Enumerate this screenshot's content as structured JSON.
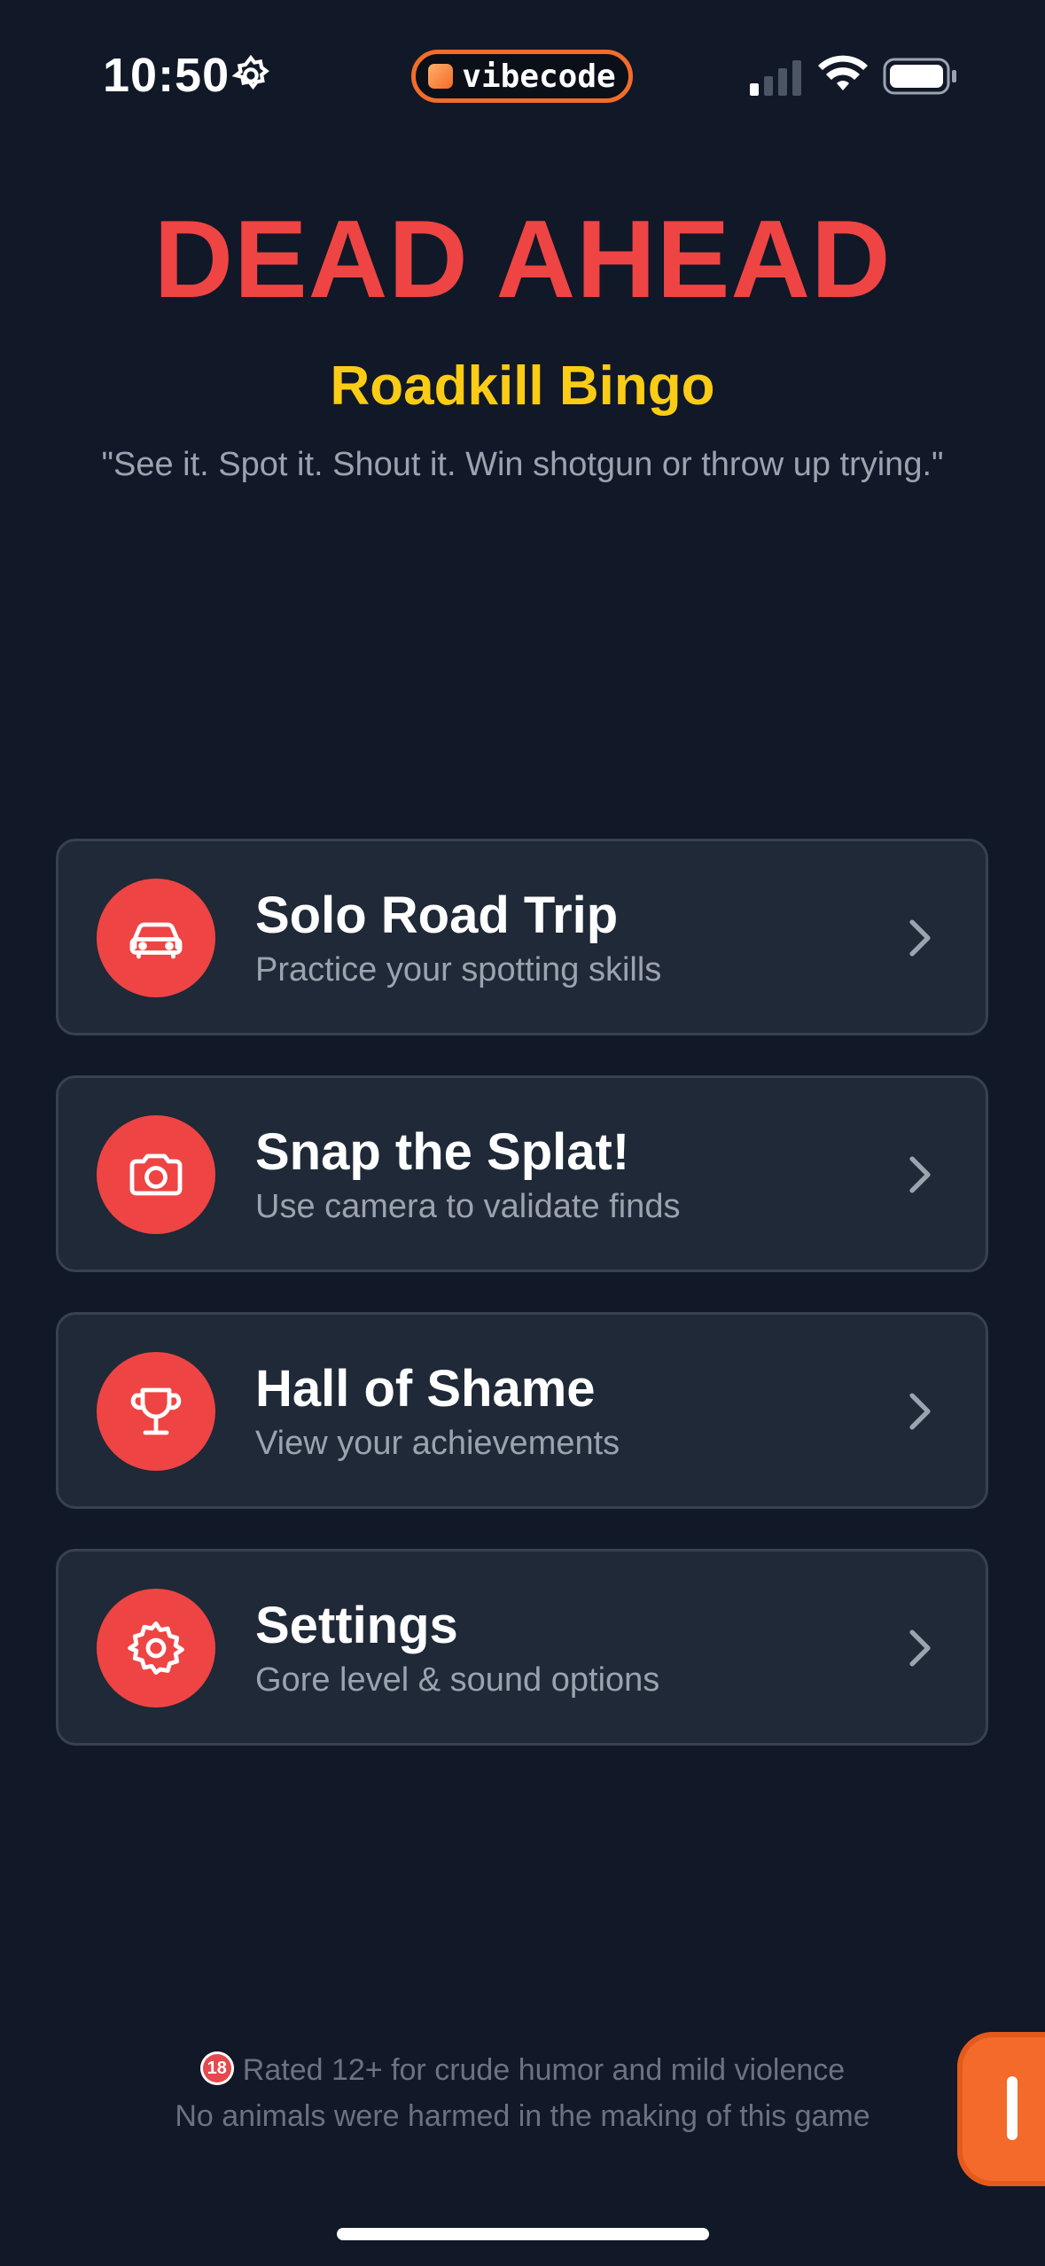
{
  "status_bar": {
    "time": "10:50",
    "pill_label": "vibecode"
  },
  "header": {
    "title": "DEAD AHEAD",
    "subtitle": "Roadkill Bingo",
    "tagline": "\"See it. Spot it. Shout it. Win shotgun or throw up trying.\""
  },
  "menu": [
    {
      "title": "Solo Road Trip",
      "subtitle": "Practice your spotting skills",
      "icon": "car-icon"
    },
    {
      "title": "Snap the Splat!",
      "subtitle": "Use camera to validate finds",
      "icon": "camera-icon"
    },
    {
      "title": "Hall of Shame",
      "subtitle": "View your achievements",
      "icon": "trophy-icon"
    },
    {
      "title": "Settings",
      "subtitle": "Gore level & sound options",
      "icon": "gear-icon"
    }
  ],
  "footer": {
    "rating_badge": "18",
    "rating_text": "Rated 12+ for crude humor and mild violence",
    "disclaimer": "No animals were harmed in the making of this game"
  },
  "colors": {
    "background": "#111827",
    "card": "#1f2937",
    "accent_red": "#ef4444",
    "accent_yellow": "#facc15",
    "accent_orange": "#f36a2a"
  }
}
